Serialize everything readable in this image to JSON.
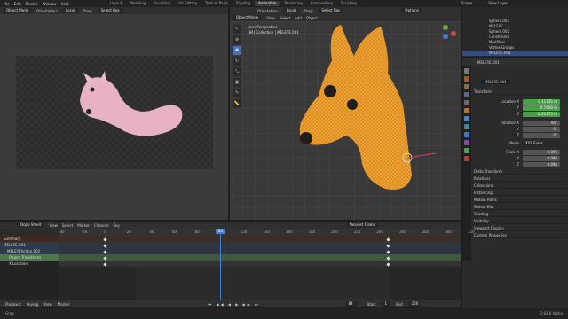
{
  "menus": [
    "File",
    "Edit",
    "Render",
    "Window",
    "Help"
  ],
  "workspaces": [
    {
      "label": "Layout",
      "active": false
    },
    {
      "label": "Modeling",
      "active": false
    },
    {
      "label": "Sculpting",
      "active": false
    },
    {
      "label": "UV Editing",
      "active": false
    },
    {
      "label": "Texture Paint",
      "active": false
    },
    {
      "label": "Shading",
      "active": false
    },
    {
      "label": "Animation",
      "active": true
    },
    {
      "label": "Rendering",
      "active": false
    },
    {
      "label": "Compositing",
      "active": false
    },
    {
      "label": "Scripting",
      "active": false
    }
  ],
  "scene": {
    "name": "Scene",
    "view_layer": "View Layer"
  },
  "left_view": {
    "mode": "Object Mode",
    "orientation": "Orientation:",
    "orientation_value": "Local",
    "drag": "Drag:",
    "select": "Select Box"
  },
  "right_view": {
    "mode": "Object Mode",
    "menu": [
      "View",
      "Select",
      "Add",
      "Object"
    ],
    "orientation": "Orientation:",
    "orientation_value": "Local",
    "drag": "Drag:",
    "select": "Select Box",
    "options": "Options",
    "perspective": "User Perspective",
    "collection": "(84) Collection | MELEYE.001"
  },
  "outliner": [
    "Sphere.003",
    "MELEYE",
    "Sphere.002",
    "Constraints",
    "Modifiers",
    "Vertex Groups",
    "MELEYE.001"
  ],
  "properties": {
    "object_name": "MELEYE.001",
    "data_name": "MELEYE.001",
    "transform_title": "Transform",
    "location_label": "Location X",
    "location": [
      "0.11135 m",
      "0.7419 m",
      "-0.21175 m"
    ],
    "rotation_label": "Rotation X",
    "rotation": [
      "90°",
      "0°",
      "0°"
    ],
    "mode_label": "Mode",
    "mode_value": "XYZ Euler",
    "scale_label": "Scale X",
    "scale": [
      "0.096",
      "0.096",
      "0.096"
    ],
    "y": "Y",
    "z": "Z",
    "sections": [
      "Delta Transform",
      "Relations",
      "Collections",
      "Instancing",
      "Motion Paths",
      "Motion Blur",
      "Shading",
      "Visibility",
      "Viewport Display",
      "Custom Properties"
    ]
  },
  "dopesheet": {
    "header": "Dope Sheet",
    "menu": [
      "View",
      "Select",
      "Marker",
      "Channel",
      "Key"
    ],
    "interp": "Nearest Frame",
    "summary": "Summary",
    "rows": [
      "MELEYE.001",
      "MELEYEAction.002",
      "Object Transforms",
      "X Location"
    ],
    "frames": [
      -40,
      -20,
      0,
      20,
      40,
      60,
      80,
      100,
      120,
      140,
      160,
      180,
      200,
      220,
      240,
      260,
      280,
      300,
      320
    ],
    "current": "84"
  },
  "playback": {
    "items": [
      "Playback",
      "Keying",
      "View",
      "Marker"
    ],
    "start_label": "Start",
    "start": "1",
    "end_label": "End",
    "end": "250",
    "frame": "84"
  },
  "status": "Grab",
  "version": "2.83.0 Alpha",
  "colors": {
    "accent": "#4772b3",
    "keyed": "#47a045",
    "selected_mesh": "#f0a030"
  }
}
